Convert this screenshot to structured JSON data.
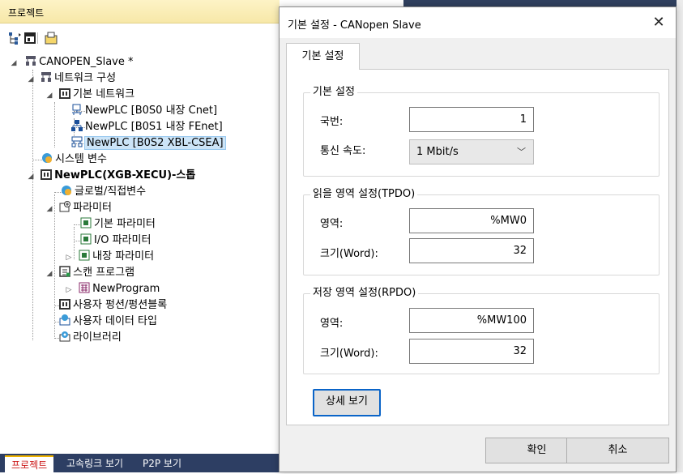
{
  "project_panel": {
    "title": "프로젝트",
    "tree": [
      {
        "label": "CANOPEN_Slave *",
        "icon": "network-root-icon"
      },
      {
        "label": "네트워크 구성",
        "icon": "network-config-icon"
      },
      {
        "label": "기본 네트워크",
        "icon": "base-network-icon"
      },
      {
        "label": "NewPLC [B0S0 내장 Cnet]",
        "icon": "cnet-icon"
      },
      {
        "label": "NewPLC [B0S1 내장 FEnet]",
        "icon": "fenet-icon"
      },
      {
        "label": "NewPLC [B0S2 XBL-CSEA]",
        "icon": "csea-icon"
      },
      {
        "label": "시스템 변수",
        "icon": "system-variable-icon"
      },
      {
        "label": "NewPLC(XGB-XECU)-스톱",
        "icon": "plc-icon"
      },
      {
        "label": "글로벌/직접변수",
        "icon": "global-variable-icon"
      },
      {
        "label": "파라미터",
        "icon": "parameter-icon"
      },
      {
        "label": "기본 파라미터",
        "icon": "basic-parameter-icon"
      },
      {
        "label": "I/O 파라미터",
        "icon": "io-parameter-icon"
      },
      {
        "label": "내장 파라미터",
        "icon": "builtin-parameter-icon"
      },
      {
        "label": "스캔 프로그램",
        "icon": "scan-program-icon"
      },
      {
        "label": "NewProgram",
        "icon": "program-icon"
      },
      {
        "label": "사용자 펑션/펑션블록",
        "icon": "user-function-icon"
      },
      {
        "label": "사용자 데이터 타입",
        "icon": "user-datatype-icon"
      },
      {
        "label": "라이브러리",
        "icon": "library-icon"
      }
    ],
    "bottom_tabs": [
      "프로젝트",
      "고속링크 보기",
      "P2P 보기"
    ]
  },
  "dialog": {
    "title": "기본 설정 - CANopen Slave",
    "close_glyph": "✕",
    "tab": "기본 설정",
    "basic_group": {
      "title": "기본 설정",
      "station_label": "국번:",
      "station_value": "1",
      "speed_label": "통신 속도:",
      "speed_value": "1 Mbit/s"
    },
    "tpdo_group": {
      "title": "읽을 영역 설정(TPDO)",
      "area_label": "영역:",
      "area_value": "%MW0",
      "size_label": "크기(Word):",
      "size_value": "32"
    },
    "rpdo_group": {
      "title": "저장 영역 설정(RPDO)",
      "area_label": "영역:",
      "area_value": "%MW100",
      "size_label": "크기(Word):",
      "size_value": "32"
    },
    "detail_button": "상세 보기",
    "ok_button": "확인",
    "cancel_button": "취소"
  },
  "colors": {
    "header_bg": "#f7e8a8",
    "selection": "#cce4f7",
    "bottom_tab_bg": "#2d3e63",
    "active_tab_text": "#cc1a1a",
    "focus_border": "#0a64c8"
  }
}
